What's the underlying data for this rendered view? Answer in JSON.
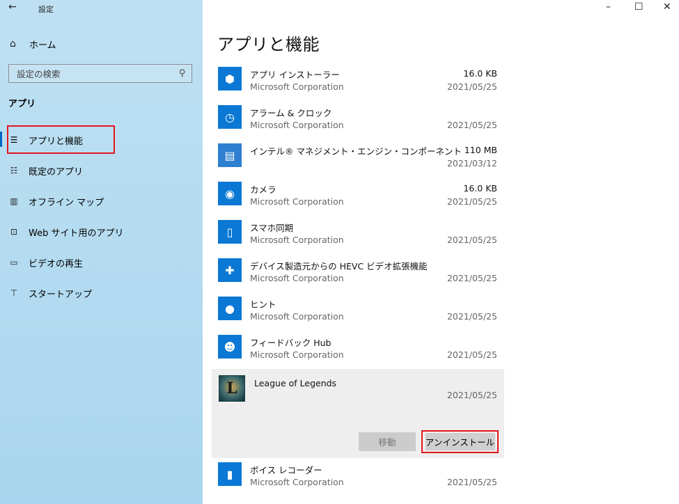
{
  "window": {
    "title": "設定",
    "minimize_icon": "minimize-icon",
    "maximize_icon": "maximize-icon",
    "close_icon": "close-icon"
  },
  "sidebar": {
    "home_label": "ホーム",
    "search_placeholder": "設定の検索",
    "section_heading": "アプリ",
    "items": [
      {
        "label": "アプリと機能",
        "icon": "apps-features-icon",
        "active": true
      },
      {
        "label": "既定のアプリ",
        "icon": "default-apps-icon"
      },
      {
        "label": "オフライン マップ",
        "icon": "offline-maps-icon"
      },
      {
        "label": "Web サイト用のアプリ",
        "icon": "web-apps-icon"
      },
      {
        "label": "ビデオの再生",
        "icon": "video-playback-icon"
      },
      {
        "label": "スタートアップ",
        "icon": "startup-icon"
      }
    ]
  },
  "main": {
    "title": "アプリと機能",
    "apps": [
      {
        "name": "アプリ インストーラー",
        "publisher": "Microsoft Corporation",
        "size": "16.0 KB",
        "date": "2021/05/25"
      },
      {
        "name": "アラーム & クロック",
        "publisher": "Microsoft Corporation",
        "size": "",
        "date": "2021/05/25"
      },
      {
        "name": "インテル® マネジメント・エンジン・コンポーネント",
        "publisher": "",
        "size": "110 MB",
        "date": "2021/03/12"
      },
      {
        "name": "カメラ",
        "publisher": "Microsoft Corporation",
        "size": "16.0 KB",
        "date": "2021/05/25"
      },
      {
        "name": "スマホ同期",
        "publisher": "Microsoft Corporation",
        "size": "",
        "date": "2021/05/25"
      },
      {
        "name": "デバイス製造元からの HEVC ビデオ拡張機能",
        "publisher": "Microsoft Corporation",
        "size": "",
        "date": "2021/05/25"
      },
      {
        "name": "ヒント",
        "publisher": "Microsoft Corporation",
        "size": "",
        "date": "2021/05/25"
      },
      {
        "name": "フィードバック Hub",
        "publisher": "Microsoft Corporation",
        "size": "",
        "date": "2021/05/25"
      }
    ],
    "selected_app": {
      "name": "League of Legends",
      "date": "2021/05/25",
      "move_label": "移動",
      "uninstall_label": "アンインストール"
    },
    "apps_after": [
      {
        "name": "ボイス レコーダー",
        "publisher": "Microsoft Corporation",
        "size": "",
        "date": "2021/05/25"
      }
    ]
  },
  "colors": {
    "accent": "#0a78d4",
    "highlight": "#e2161d",
    "sidebar_bg": "#b4dbf0"
  }
}
